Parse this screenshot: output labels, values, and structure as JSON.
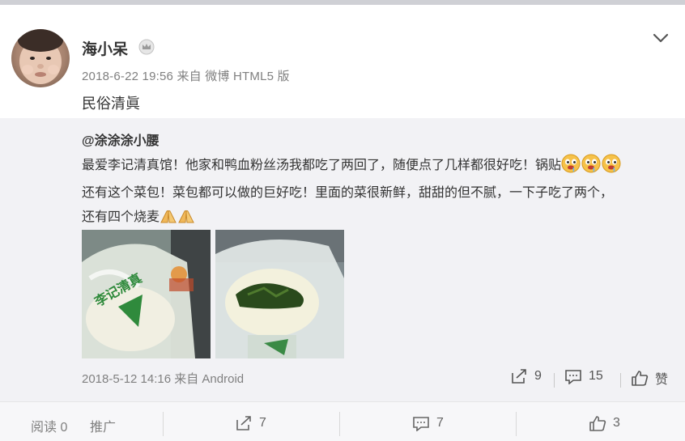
{
  "post": {
    "author": "海小呆",
    "meta": "2018-6-22 19:56 来自 微博 HTML5 版",
    "text": "民俗清眞"
  },
  "repost": {
    "author": "@涂涂涂小腰",
    "line1": "最爱李记清真馆！他家和鸭血粉丝汤我都吃了两回了，随便点了几样都很好吃！锅贴",
    "line2": "还有这个菜包！菜包都可以做的巨好吃！里面的菜很新鲜，甜甜的但不腻，一下子吃了两个，",
    "line3": "还有四个烧麦",
    "photo1_text": "李记清真",
    "meta": "2018-5-12 14:16 来自 Android",
    "forward_count": "9",
    "comment_count": "15",
    "like_label": "赞"
  },
  "footer": {
    "read": "阅读 0",
    "promote": "推广",
    "forward_count": "7",
    "comment_count": "7",
    "like_count": "3"
  },
  "icons": {
    "badge": "crown-badge-icon",
    "more": "chevron-down-icon",
    "forward": "share-icon",
    "comment": "comment-icon",
    "like": "thumbs-up-icon"
  },
  "colors": {
    "meta_gray": "#808080",
    "repost_bg": "#f2f2f5",
    "footer_bg": "#f7f7f9"
  }
}
